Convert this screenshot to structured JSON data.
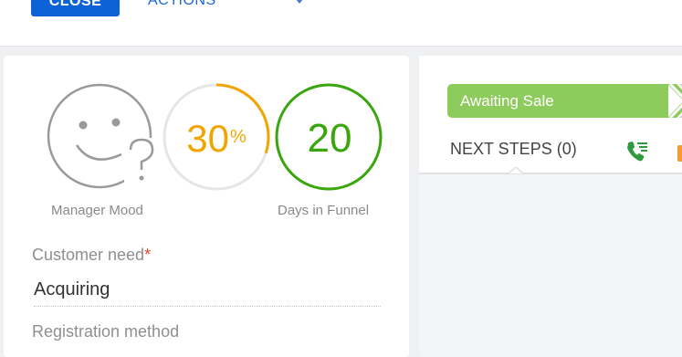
{
  "toolbar": {
    "close_label": "CLOSE",
    "actions_label": "ACTIONS"
  },
  "metrics": {
    "mood_label": "Manager Mood",
    "probability_value": "30",
    "probability_unit": "%",
    "probability_fraction": 0.3,
    "days_value": "20",
    "days_label": "Days in Funnel"
  },
  "fields": {
    "customer_need_label": "Customer need",
    "customer_need_required": "*",
    "customer_need_value": "Acquiring",
    "registration_label": "Registration method"
  },
  "stage": {
    "current": "Awaiting Sale",
    "color": "#8dcb5c"
  },
  "tabs": {
    "next_steps_label": "NEXT STEPS (0)"
  },
  "colors": {
    "accent_blue": "#0d63d6",
    "probability": "#f0a500",
    "days": "#3aa60e",
    "mood": "#9a9a9a"
  },
  "icons": {
    "mood": "sad-question-face-icon",
    "next_step_call": "phone-list-icon"
  }
}
